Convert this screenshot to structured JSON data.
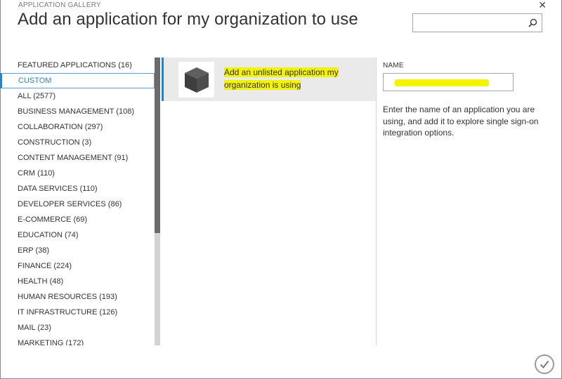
{
  "header": {
    "kicker": "APPLICATION GALLERY",
    "title": "Add an application for my organization to use",
    "close_glyph": "✕"
  },
  "search": {
    "value": "",
    "placeholder": ""
  },
  "categories": [
    {
      "label": "FEATURED APPLICATIONS (16)"
    },
    {
      "label": "CUSTOM",
      "selected": true
    },
    {
      "label": "ALL (2577)"
    },
    {
      "label": "BUSINESS MANAGEMENT (108)"
    },
    {
      "label": "COLLABORATION (297)"
    },
    {
      "label": "CONSTRUCTION (3)"
    },
    {
      "label": "CONTENT MANAGEMENT (91)"
    },
    {
      "label": "CRM (110)"
    },
    {
      "label": "DATA SERVICES (110)"
    },
    {
      "label": "DEVELOPER SERVICES (86)"
    },
    {
      "label": "E-COMMERCE (69)"
    },
    {
      "label": "EDUCATION (74)"
    },
    {
      "label": "ERP (38)"
    },
    {
      "label": "FINANCE (224)"
    },
    {
      "label": "HEALTH (48)"
    },
    {
      "label": "HUMAN RESOURCES (193)"
    },
    {
      "label": "IT INFRASTRUCTURE (126)"
    },
    {
      "label": "MAIL (23)"
    },
    {
      "label": "MARKETING (172)"
    }
  ],
  "app_list": {
    "item": {
      "icon": "cube-icon",
      "label": "Add an unlisted application my organization is using"
    }
  },
  "form": {
    "name_label": "NAME",
    "name_value": "",
    "help": "Enter the name of an application you are using, and add it to explore single sign-on integration options."
  },
  "colors": {
    "accent": "#2f7fc1",
    "highlight": "#f4f400",
    "tile_bg": "#eaeaea"
  }
}
